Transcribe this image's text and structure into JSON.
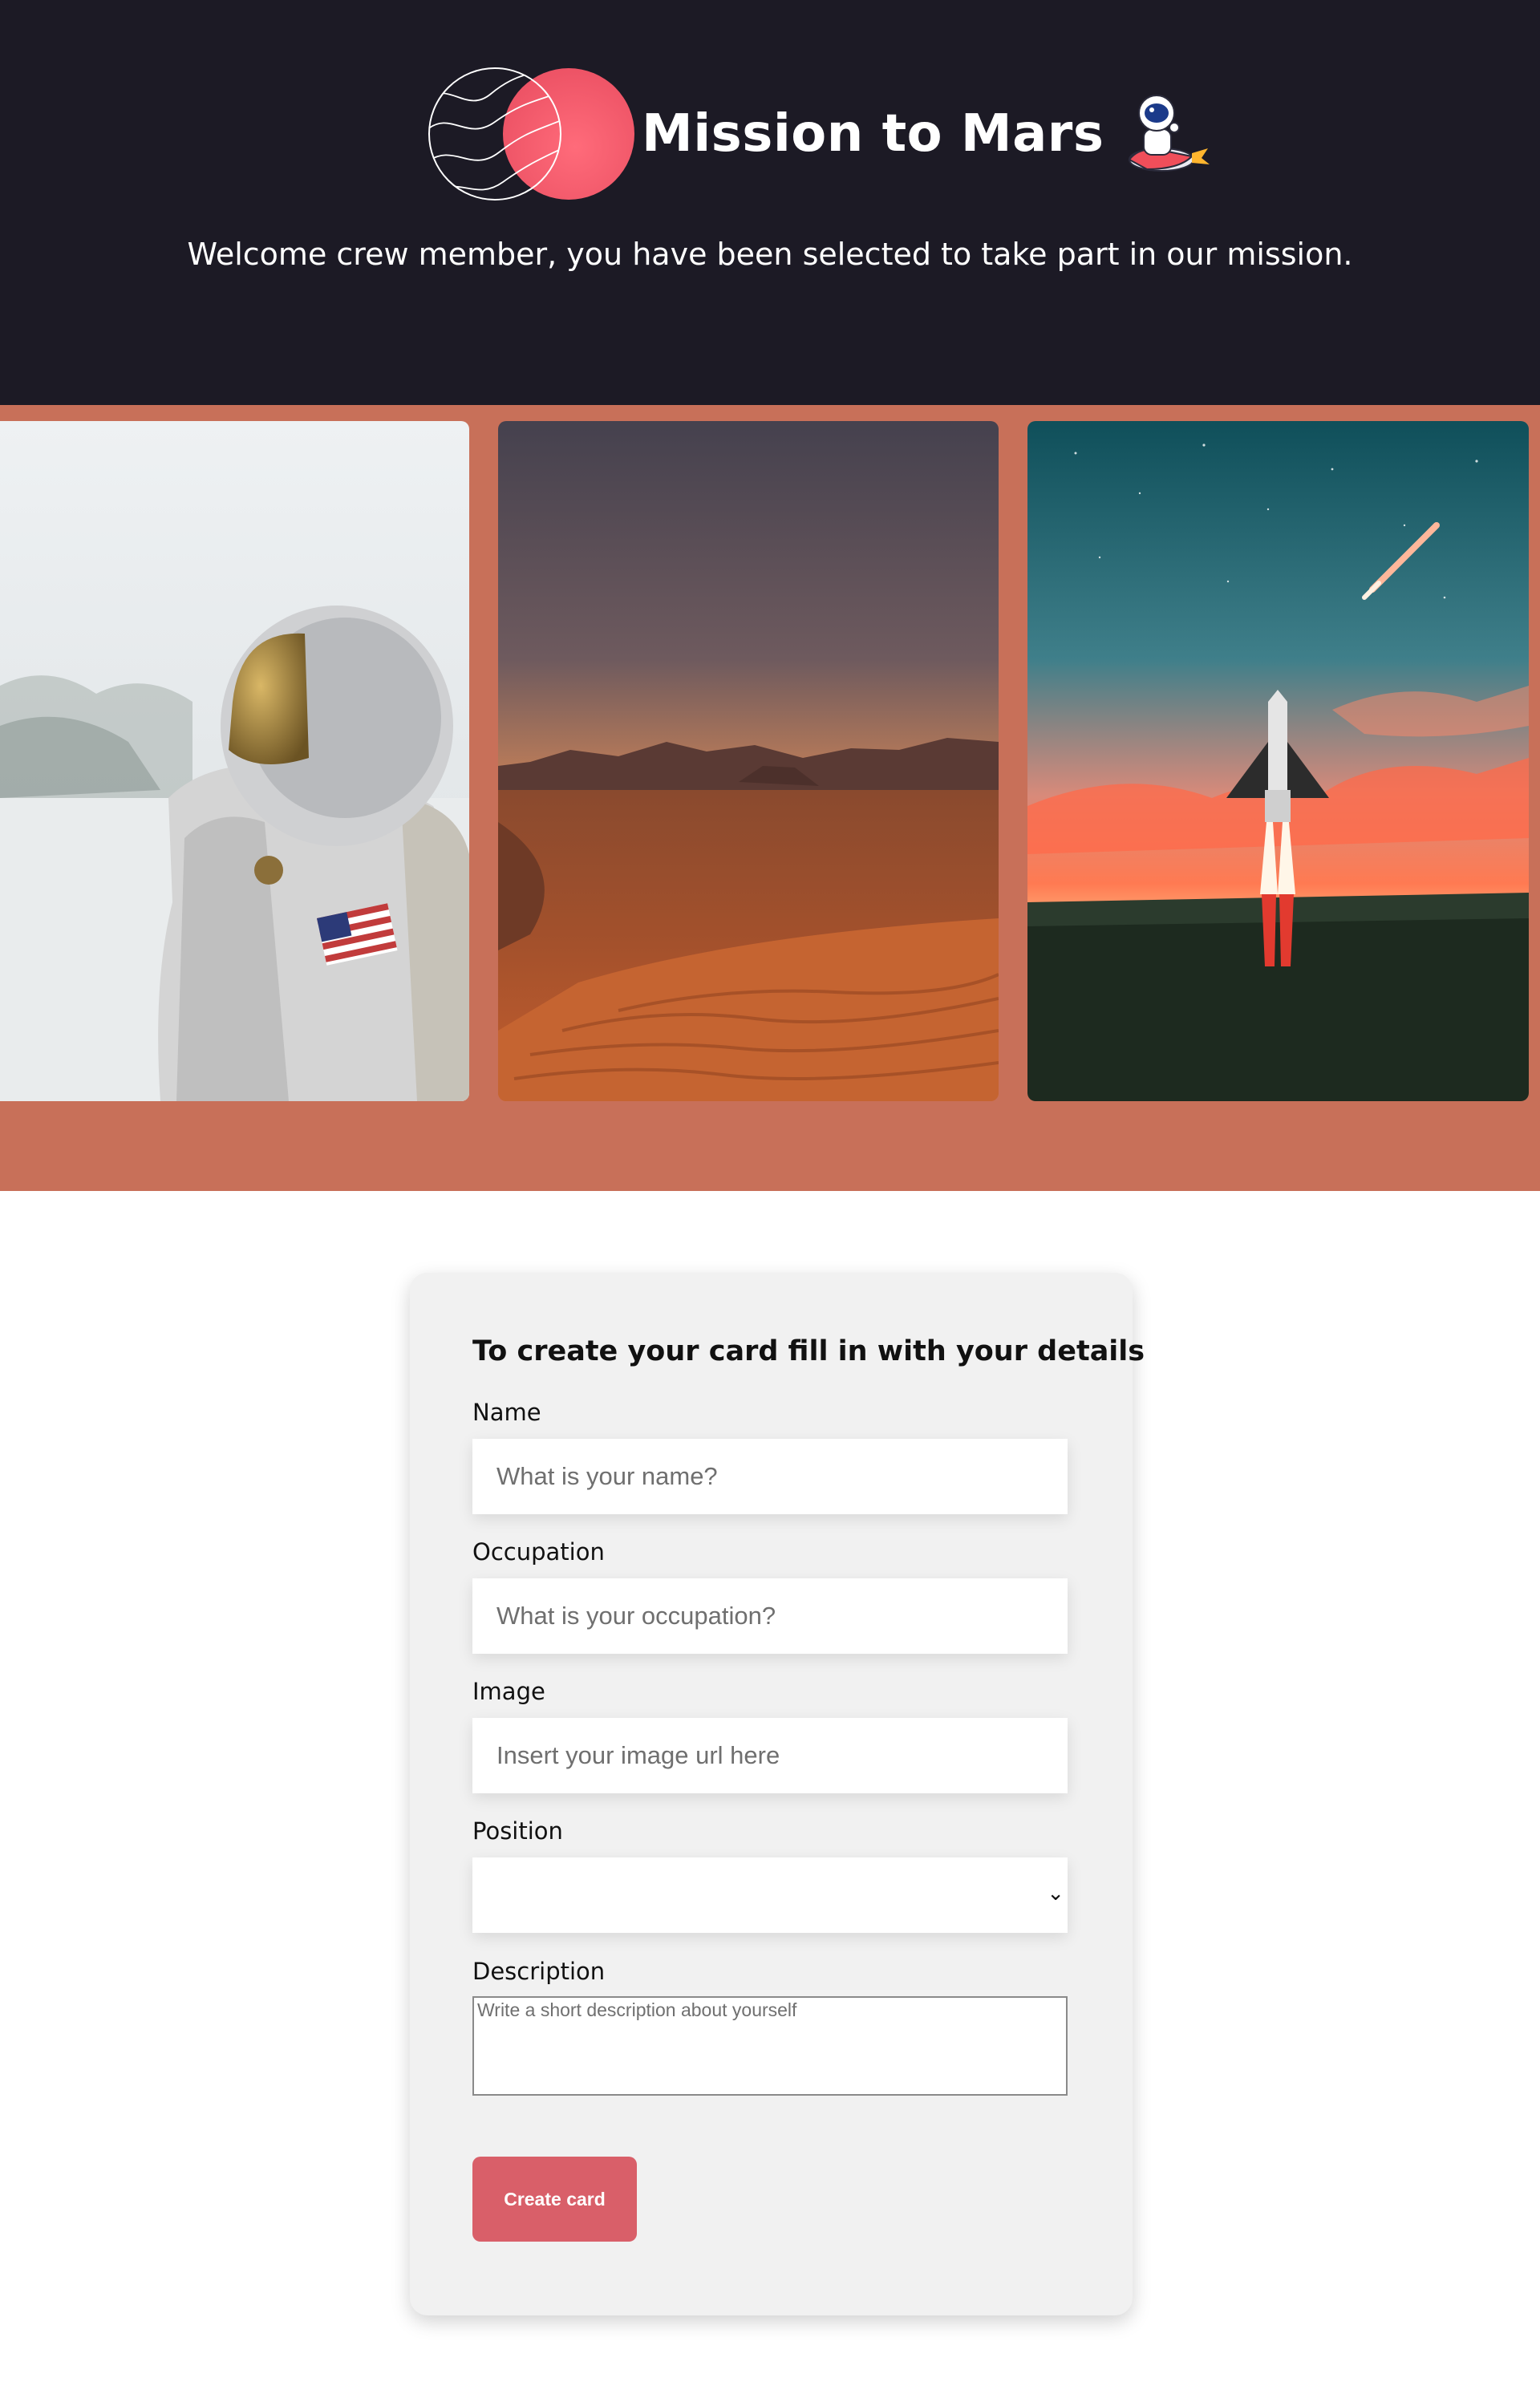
{
  "header": {
    "title": "Mission to Mars",
    "welcome": "Welcome crew member, you have been selected to take part in our mission."
  },
  "gallery": {
    "photos": [
      "astronaut-photo",
      "mars-desert-photo",
      "rocket-launch-photo"
    ]
  },
  "form": {
    "title": "To create your card fill in with your details",
    "name_label": "Name",
    "name_placeholder": "What is your name?",
    "occupation_label": "Occupation",
    "occupation_placeholder": "What is your occupation?",
    "image_label": "Image",
    "image_placeholder": "Insert your image url here",
    "position_label": "Position",
    "position_value": "",
    "description_label": "Description",
    "description_placeholder": "Write a short description about yourself",
    "submit_label": "Create card"
  },
  "colors": {
    "header_bg": "#1c1a25",
    "gallery_bg": "#c87059",
    "button": "#d95f69",
    "planet": "#f05a6e"
  }
}
